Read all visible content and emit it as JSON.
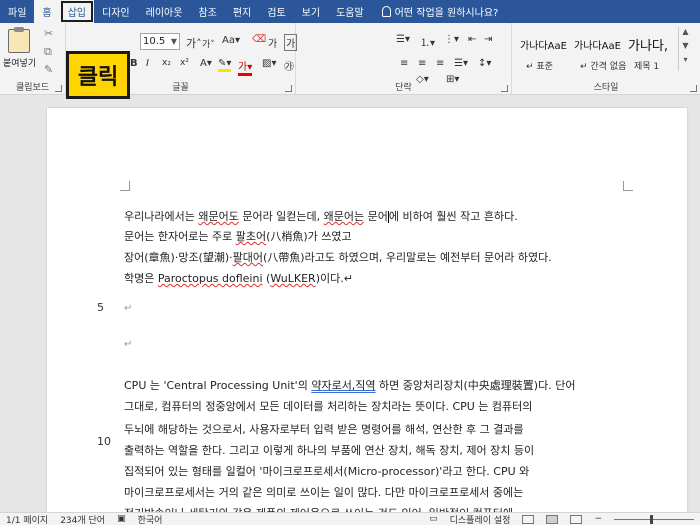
{
  "tabs": [
    "파일",
    "홈",
    "삽입",
    "디자인",
    "레이아웃",
    "참조",
    "편지",
    "검토",
    "보기",
    "도움말"
  ],
  "tell_me": "어떤 작업을 원하시나요?",
  "callout": "클릭",
  "ribbon": {
    "clipboard": {
      "paste": "붙여넣기",
      "label": "클립보드"
    },
    "font": {
      "size": "10.5",
      "label": "글꼴",
      "grow": "가",
      "shrink": "가",
      "case": "Aa",
      "clear": "가",
      "charbox": "가"
    },
    "paragraph": {
      "label": "단락"
    },
    "styles": {
      "label": "스타일",
      "items": [
        {
          "sample": "가나다AaE",
          "name": "↵ 표준"
        },
        {
          "sample": "가나다AaE",
          "name": "↵ 간격 없음"
        },
        {
          "sample": "가나다,",
          "name": "제목 1"
        }
      ]
    }
  },
  "document": {
    "lines": [
      {
        "segments": [
          {
            "t": "우리나라에서는 "
          },
          {
            "t": "왜문어도",
            "s": "red"
          },
          {
            "t": " 문어라 일컫는데, "
          },
          {
            "t": "왜문어는",
            "s": "red"
          },
          {
            "t": " 문어"
          },
          {
            "t": "|",
            "s": "cursor"
          },
          {
            "t": "에 비하여 훨씬 작고 흔하다."
          }
        ]
      },
      {
        "segments": [
          {
            "t": "문어는 한자어로는 주로 "
          },
          {
            "t": "팔초어",
            "s": "red"
          },
          {
            "t": "(八梢魚)가 쓰였고"
          }
        ]
      },
      {
        "segments": [
          {
            "t": "장어(章魚)·망조(望潮)·"
          },
          {
            "t": "팔대어",
            "s": "red"
          },
          {
            "t": "(八帶魚)라고도 하였으며, 우리말로는 예전부터 문어라 하였다."
          }
        ]
      },
      {
        "segments": [
          {
            "t": "학명은 "
          },
          {
            "t": "Paroctopus dofleini",
            "s": "red"
          },
          {
            "t": " ("
          },
          {
            "t": "WuLKER",
            "s": "red"
          },
          {
            "t": ")이다.↵"
          }
        ]
      },
      {
        "segments": [
          {
            "t": "↵",
            "s": "mark"
          }
        ]
      },
      {
        "segments": [
          {
            "t": "↵",
            "s": "mark"
          }
        ]
      },
      {
        "segments": [
          {
            "t": "CPU 는 'Central Processing Unit'의 "
          },
          {
            "t": "약자로서,직역",
            "s": "blue"
          },
          {
            "t": " 하면 중앙처리장치(中央處理裝置)다. 단어"
          }
        ]
      },
      {
        "segments": [
          {
            "t": "그대로, 컴퓨터의 정중앙에서 모든 데이터를 처리하는 장치라는 뜻이다. CPU 는 컴퓨터의"
          }
        ]
      },
      {
        "segments": [
          {
            "t": "두뇌에 해당하는 것으로서, 사용자로부터 입력 받은 명령어를 해석, 연산한 후 그 결과를"
          }
        ]
      },
      {
        "segments": [
          {
            "t": "출력하는 역할을 한다. 그리고 이렇게 하나의 부품에 연산 장치, 해독 장치, 제어 장치 등이"
          }
        ]
      },
      {
        "segments": [
          {
            "t": "집적되어 있는 형태를 일컬어 '마이크로프로세서(Micro-processor)'라고 한다. CPU 와"
          }
        ]
      },
      {
        "segments": [
          {
            "t": "마이크로프로세서는 거의 같은 의미로 쓰이는 일이 많다. 다만 마이크로프로세서 중에는"
          }
        ]
      },
      {
        "segments": [
          {
            "t": "전기밥솥이나 세탁기와 같은 제품의 제어용으로 쓰이는 것도 있어, 일반적인 컴퓨터에"
          }
        ]
      }
    ],
    "line_numbers": [
      "5",
      "10"
    ]
  },
  "status": {
    "page": "1/1 페이지",
    "words": "234개 단어",
    "lang": "한국어",
    "display": "디스플레이 설정"
  }
}
